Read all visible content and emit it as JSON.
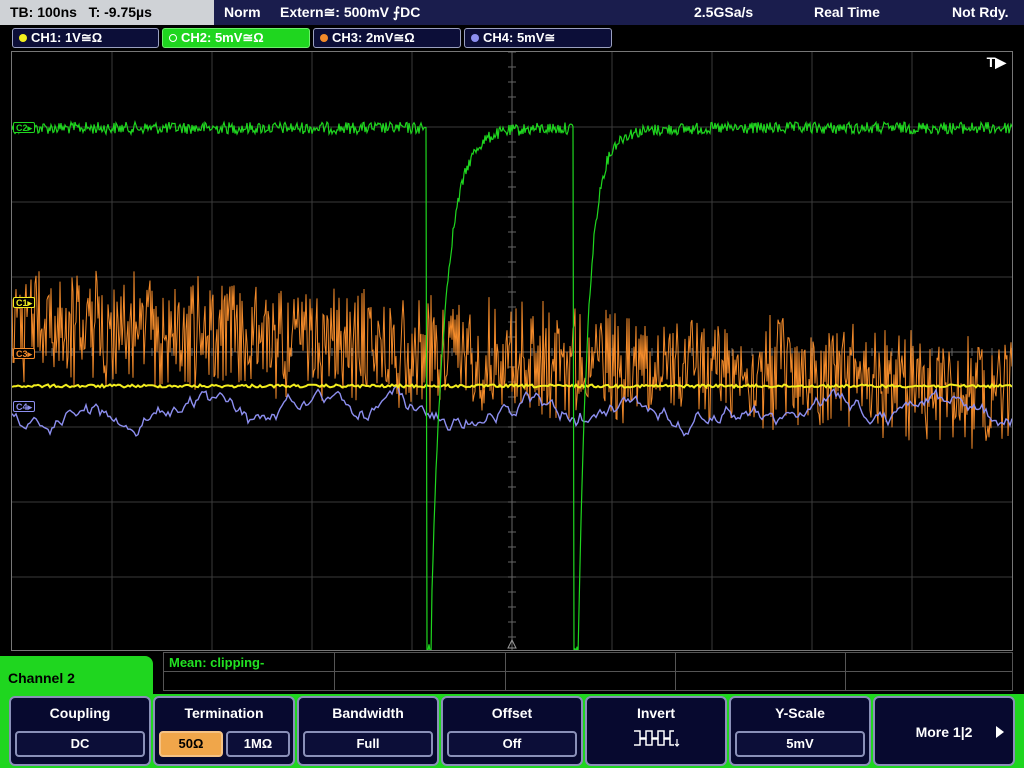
{
  "status": {
    "timebase": "TB: 100ns   T: -9.75µs",
    "mode": "Norm",
    "trigger": "Extern≅: 500mV ⨍DC",
    "sample_rate": "2.5GSa/s",
    "acq": "Real Time",
    "state": "Not Rdy."
  },
  "channels": [
    {
      "label": "CH1: 1V≅Ω",
      "color": "#f2ee1e"
    },
    {
      "label": "CH2: 5mV≅Ω",
      "color": "#1fd61f"
    },
    {
      "label": "CH3: 2mV≅Ω",
      "color": "#f28a2a"
    },
    {
      "label": "CH4: 5mV≅",
      "color": "#8d8ff0"
    }
  ],
  "screen": {
    "trigger_marker": "T▶",
    "tags": {
      "c2": "C2▸",
      "c1": "C1▸",
      "c3": "C3▸",
      "c4": "C4▸"
    }
  },
  "measurement": "Mean: clipping-",
  "menu_title": "Channel 2",
  "softkeys": {
    "coupling": {
      "label": "Coupling",
      "value": "DC"
    },
    "termination": {
      "label": "Termination",
      "opt1": "50Ω",
      "opt2": "1MΩ",
      "selected": "50Ω"
    },
    "bandwidth": {
      "label": "Bandwidth",
      "value": "Full"
    },
    "offset": {
      "label": "Offset",
      "value": "Off"
    },
    "invert": {
      "label": "Invert",
      "icon": "invert-pulse-icon"
    },
    "yscale": {
      "label": "Y-Scale",
      "value": "5mV"
    },
    "more": {
      "label": "More 1|2",
      "icon": "arrow-right-icon"
    }
  }
}
